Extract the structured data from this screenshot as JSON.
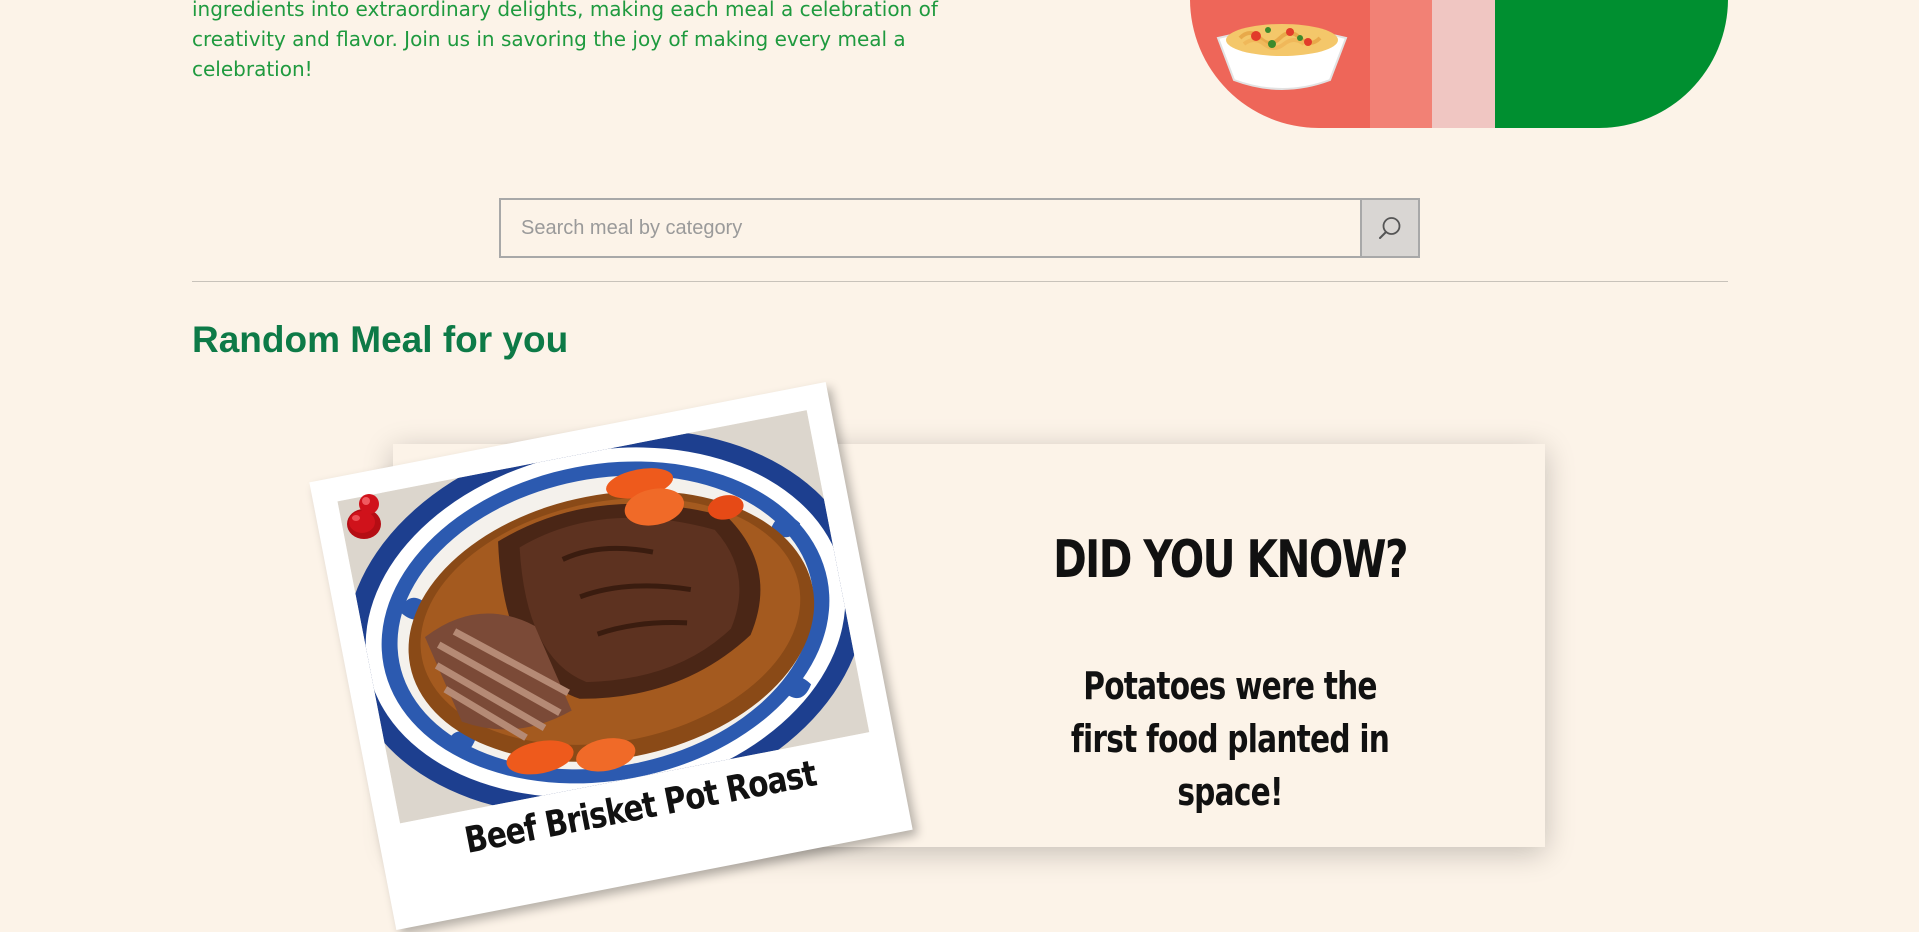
{
  "intro": {
    "text": "ingredients into extraordinary delights, making each meal a celebration of creativity and flavor. Join us in savoring the joy of making every meal a celebration!"
  },
  "banner": {
    "colors": [
      "#ee6659",
      "#f28175",
      "#f0c6c2",
      "#008f30"
    ],
    "image": "pasta-bowl"
  },
  "search": {
    "placeholder": "Search meal by category",
    "value": "",
    "icon": "search-icon"
  },
  "random_meal": {
    "heading": "Random Meal for you",
    "meal_name": "Beef Brisket Pot Roast",
    "image": "beef-brisket-photo"
  },
  "fact": {
    "title": "DID YOU KNOW?",
    "text": "Potatoes were the first food planted in space!"
  },
  "colors": {
    "background": "#fcf3e8",
    "accent_green": "#0d7a47",
    "text_green": "#1f9a3f",
    "pin_red": "#d0121b"
  }
}
